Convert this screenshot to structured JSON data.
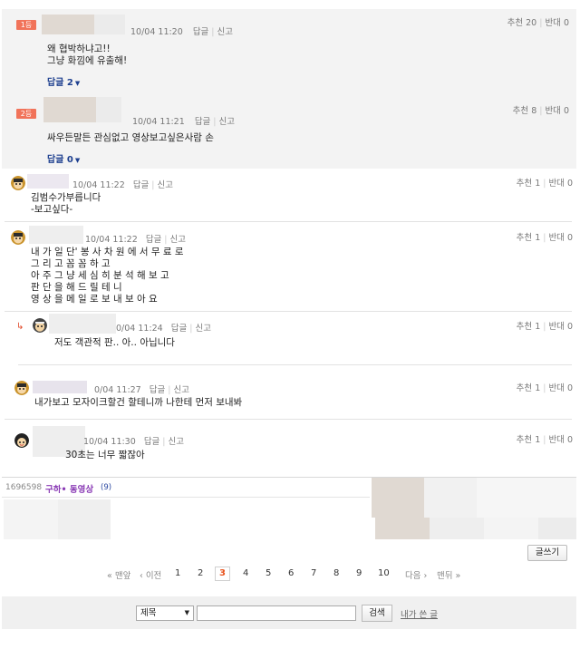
{
  "labels": {
    "reply": "답글",
    "report": "신고",
    "upvote": "추천",
    "downvote": "반대"
  },
  "best": [
    {
      "rank": "1등",
      "time": "10/04 11:20",
      "up": "20",
      "down": "0",
      "lines": [
        "왜 협박하냐고!!",
        "그냥 화낌에 유출해!"
      ],
      "replies": "답글 2"
    },
    {
      "rank": "2등",
      "time": "10/04 11:21",
      "up": "8",
      "down": "0",
      "lines": [
        "싸우든말든 관심없고 영상보고싶은사람 손"
      ],
      "replies": "답글 0"
    }
  ],
  "comments": [
    {
      "time": "10/04 11:22",
      "up": "1",
      "down": "0",
      "lines": [
        "김범수가부릅니다",
        "-보고싶다-"
      ]
    },
    {
      "time": "10/04 11:22",
      "up": "1",
      "down": "0",
      "lines": [
        "내 가 일 단' 봉 사 차 원 에 서 무 료 로",
        "그 리 고 꼼 꼼 하 고",
        "아 주 그 냥 세 심 히 분 석 해 보 고",
        "판 단 을 해 드 릴 테 니",
        "영 상 을 메 일 로 보 내 보 아 요"
      ]
    },
    {
      "time": "0/04 11:24",
      "up": "1",
      "down": "0",
      "lines": [
        "저도 객관적 판.. 아.. 아닙니다"
      ]
    },
    {
      "time": "0/04 11:27",
      "up": "1",
      "down": "0",
      "lines": [
        "내가보고 모자이크할건 할테니까 나한테 먼저 보내봐"
      ]
    },
    {
      "time": "10/04 11:30",
      "up": "1",
      "down": "0",
      "lines": [
        "30초는 너무 짧잖아"
      ]
    }
  ],
  "list": {
    "number": "1696598",
    "category": "구하• 동영상",
    "count": "(9)"
  },
  "write_button": "글쓰기",
  "pagination": {
    "first": "« 맨앞",
    "prev": "‹ 이전",
    "pages": [
      "1",
      "2",
      "3",
      "4",
      "5",
      "6",
      "7",
      "8",
      "9",
      "10"
    ],
    "current": "3",
    "next": "다음 ›",
    "last": "맨뒤 »"
  },
  "search": {
    "select_value": "제목",
    "input_value": "",
    "button": "검색",
    "my_posts": "내가 쓴 글"
  }
}
